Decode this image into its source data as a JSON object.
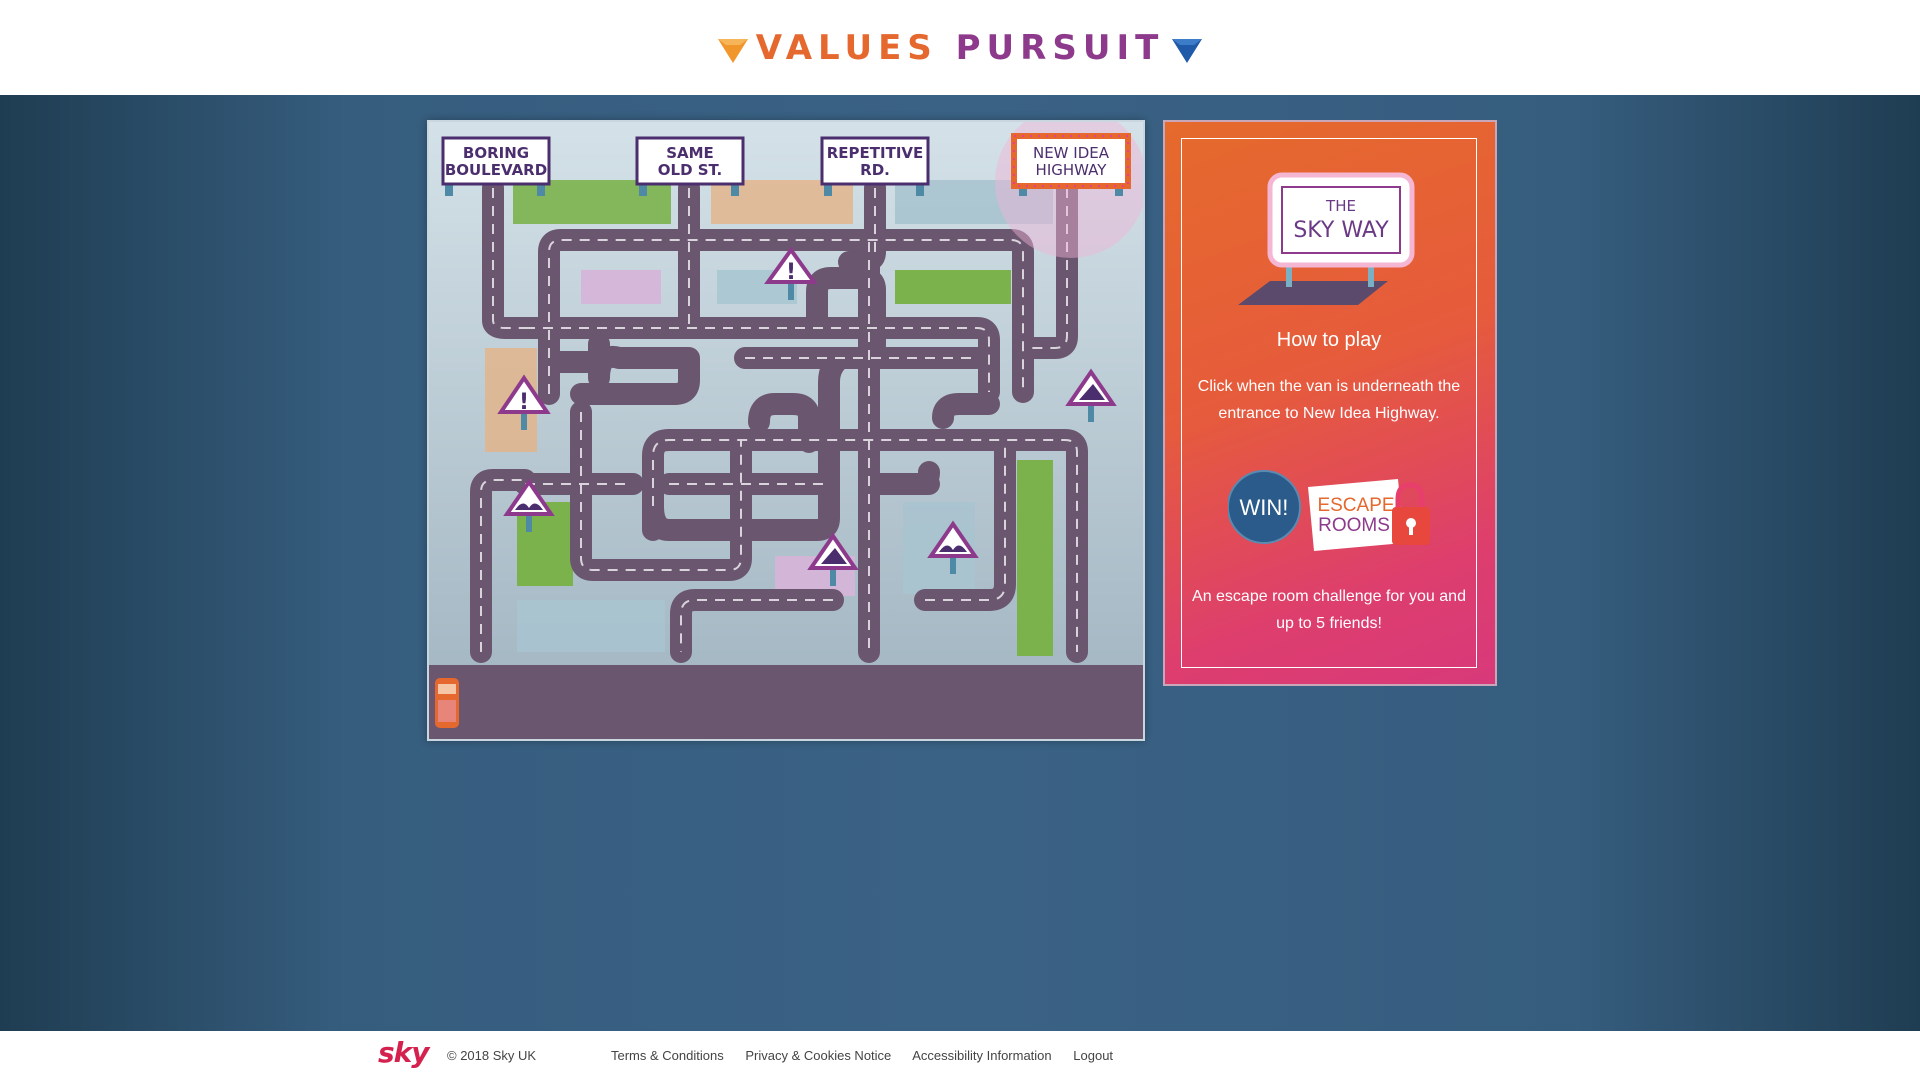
{
  "header": {
    "title_word1": "VALUES",
    "title_word2": "PURSUIT"
  },
  "board": {
    "signs": [
      "BORING",
      "BOULEVARD",
      "SAME",
      "OLD ST.",
      "REPETITIVE",
      "RD.",
      "NEW IDEA",
      "HIGHWAY"
    ]
  },
  "panel": {
    "skyway_the": "THE",
    "skyway_name": "SKY WAY",
    "how_to_play": "How to play",
    "instructions": "Click when the van is underneath the entrance to New Idea Highway.",
    "win_label": "WIN!",
    "escape_line1": "ESCAPE",
    "escape_line2": "ROOMS",
    "escape_desc": "An escape room challenge for you and up to 5 friends!"
  },
  "footer": {
    "logo": "sky",
    "copyright": "© 2018 Sky UK",
    "links": [
      "Terms & Conditions",
      "Privacy & Cookies Notice",
      "Accessibility Information",
      "Logout"
    ]
  },
  "colors": {
    "orange": "#e5682e",
    "purple": "#8e3a8c",
    "road": "#6b5670",
    "navy": "#2a5b8a"
  }
}
